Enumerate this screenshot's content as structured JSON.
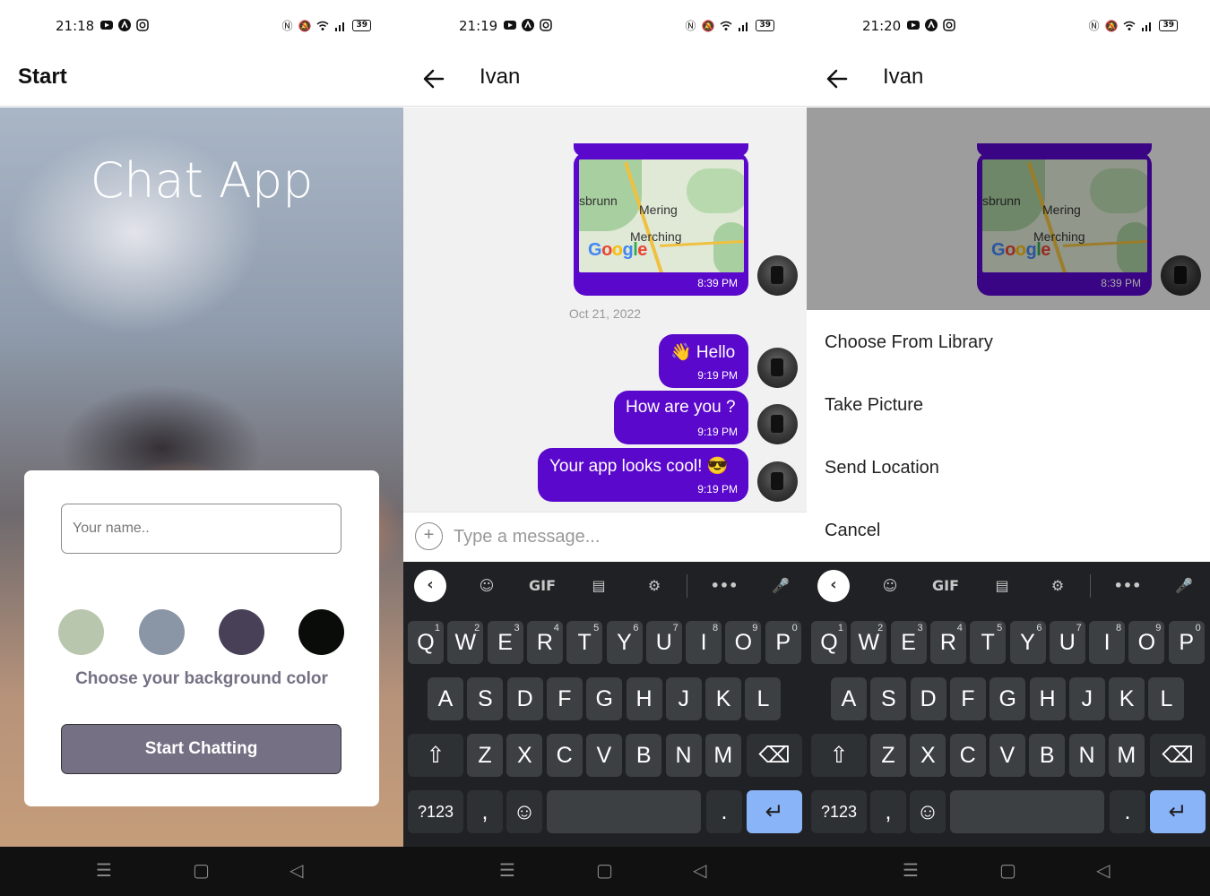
{
  "screens": [
    {
      "status": {
        "time": "21:18",
        "battery": "39"
      },
      "header": {
        "title": "Start"
      },
      "app_title": "Chat App",
      "name_placeholder": "Your name..",
      "colors": [
        "#b9c6ae",
        "#8a95a5",
        "#474056",
        "#090c08"
      ],
      "choose_label": "Choose your background color",
      "start_button": "Start Chatting"
    },
    {
      "status": {
        "time": "21:19",
        "battery": "39"
      },
      "header": {
        "title": "Ivan"
      },
      "map_message": {
        "labels": [
          "sbrunn",
          "Mering",
          "Merching"
        ],
        "google": [
          "G",
          "o",
          "o",
          "g",
          "l",
          "e"
        ],
        "time": "8:39 PM"
      },
      "date_separator": "Oct 21, 2022",
      "messages": [
        {
          "text": "👋 Hello",
          "time": "9:19 PM"
        },
        {
          "text": "How are you ?",
          "time": "9:19 PM"
        },
        {
          "text": "Your app looks cool! 😎",
          "time": "9:19 PM"
        }
      ],
      "input_placeholder": "Type a message...",
      "plus_icon": "+"
    },
    {
      "status": {
        "time": "21:20",
        "battery": "39"
      },
      "header": {
        "title": "Ivan"
      },
      "map_message": {
        "labels": [
          "sbrunn",
          "Mering",
          "Merching"
        ],
        "google": [
          "G",
          "o",
          "o",
          "g",
          "l",
          "e"
        ],
        "time": "8:39 PM"
      },
      "action_sheet": [
        "Choose From Library",
        "Take Picture",
        "Send Location",
        "Cancel"
      ]
    }
  ],
  "keyboard": {
    "toolbar": {
      "back": "‹",
      "sticker": "☺",
      "gif": "GIF",
      "clipboard": "▤",
      "settings": "⚙",
      "more": "•••",
      "mic": "🎤"
    },
    "row1": [
      {
        "k": "Q",
        "n": "1"
      },
      {
        "k": "W",
        "n": "2"
      },
      {
        "k": "E",
        "n": "3"
      },
      {
        "k": "R",
        "n": "4"
      },
      {
        "k": "T",
        "n": "5"
      },
      {
        "k": "Y",
        "n": "6"
      },
      {
        "k": "U",
        "n": "7"
      },
      {
        "k": "I",
        "n": "8"
      },
      {
        "k": "O",
        "n": "9"
      },
      {
        "k": "P",
        "n": "0"
      }
    ],
    "row2": [
      "A",
      "S",
      "D",
      "F",
      "G",
      "H",
      "J",
      "K",
      "L"
    ],
    "row3": [
      "Z",
      "X",
      "C",
      "V",
      "B",
      "N",
      "M"
    ],
    "shift": "⇧",
    "backspace": "⌫",
    "symbols": "?123",
    "comma": ",",
    "emoji": "☺",
    "period": ".",
    "enter": "↵"
  },
  "navbar": {
    "menu": "☰",
    "home": "▢",
    "back": "◁"
  },
  "google_colors": [
    "#4285f4",
    "#ea4335",
    "#fbbc05",
    "#4285f4",
    "#34a853",
    "#ea4335"
  ]
}
